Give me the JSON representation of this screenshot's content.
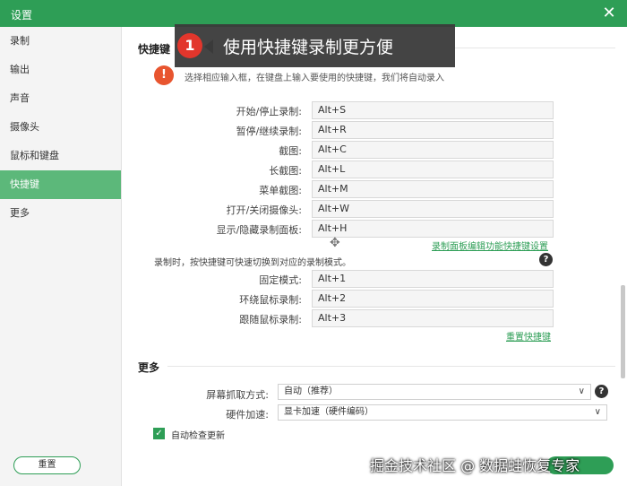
{
  "window": {
    "title": "设置",
    "close_label": "✕"
  },
  "sidebar": {
    "items": [
      {
        "label": "录制"
      },
      {
        "label": "输出"
      },
      {
        "label": "声音"
      },
      {
        "label": "摄像头"
      },
      {
        "label": "鼠标和键盘"
      },
      {
        "label": "快捷键"
      },
      {
        "label": "更多"
      }
    ],
    "active": "快捷键"
  },
  "hotkeys": {
    "section_title": "快捷键",
    "warn_icon": "!",
    "hint": "选择相应输入框，在键盘上输入要使用的快捷键，我们将自动录入",
    "rows": [
      {
        "label": "开始/停止录制:",
        "value": "Alt+S"
      },
      {
        "label": "暂停/继续录制:",
        "value": "Alt+R"
      },
      {
        "label": "截图:",
        "value": "Alt+C"
      },
      {
        "label": "长截图:",
        "value": "Alt+L"
      },
      {
        "label": "菜单截图:",
        "value": "Alt+M"
      },
      {
        "label": "打开/关闭摄像头:",
        "value": "Alt+W"
      },
      {
        "label": "显示/隐藏录制面板:",
        "value": "Alt+H"
      }
    ],
    "panel_link": "录制面板编辑功能快捷键设置",
    "mode_desc": "录制时，按快捷键可快速切换到对应的录制模式。",
    "help_icon": "?",
    "mode_rows": [
      {
        "label": "固定模式:",
        "value": "Alt+1"
      },
      {
        "label": "环绕鼠标录制:",
        "value": "Alt+2"
      },
      {
        "label": "跟随鼠标录制:",
        "value": "Alt+3"
      }
    ],
    "reset_link": "重置快捷键"
  },
  "more": {
    "section_title": "更多",
    "capture_label": "屏幕抓取方式:",
    "capture_value": "自动（推荐）",
    "hw_label": "硬件加速:",
    "hw_value": "显卡加速（硬件编码）",
    "auto_update_label": "自动检查更新"
  },
  "footer": {
    "reset_label": "重置"
  },
  "callout": {
    "number": "1",
    "text": "使用快捷键录制更方便"
  },
  "watermark": "掘金技术社区 @ 数据蛙恢复专家",
  "colors": {
    "accent": "#2e9e56",
    "sidebar_active": "#5cb87a",
    "warn": "#e8552f",
    "callout_badge": "#e2362c"
  }
}
